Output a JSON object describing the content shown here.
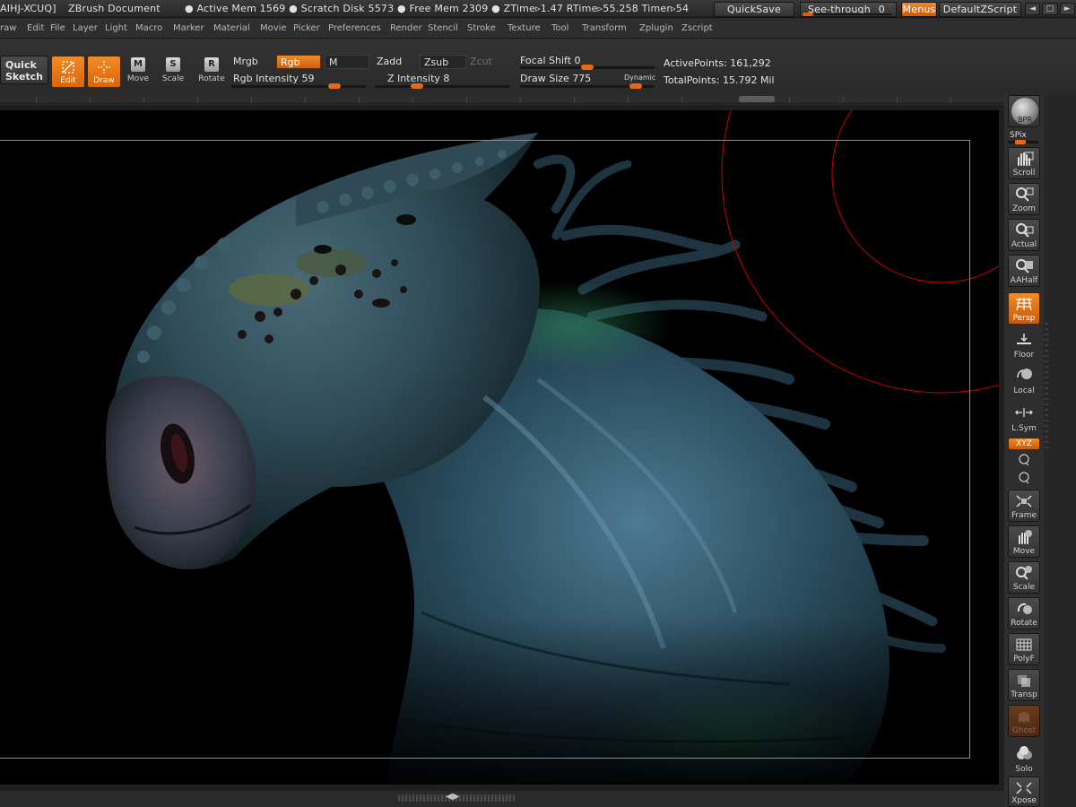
{
  "titlebar": {
    "id": "AIHJ-XCUQ]",
    "document": "ZBrush Document",
    "stats": "● Active Mem 1569 ● Scratch Disk 5573 ● Free Mem 2309 ● ZTime▹1.47 RTime▹55.258 Timer▹54",
    "quicksave": "QuickSave",
    "see_through_label": "See-through",
    "see_through_value": "0",
    "see_through_level": 0.0,
    "menus": "Menus",
    "default_zscript": "DefaultZScript",
    "window_controls": [
      "◄",
      "□",
      "►"
    ]
  },
  "menubar": {
    "items": [
      "raw",
      "Edit",
      "File",
      "Layer",
      "Light",
      "Macro",
      "Marker",
      "Material",
      "Movie",
      "Picker",
      "Preferences",
      "Render",
      "Stencil",
      "Stroke",
      "Texture",
      "Tool",
      "Transform",
      "Zplugin",
      "Zscript"
    ]
  },
  "shelf": {
    "quick_sketch_line1": "Quick",
    "quick_sketch_line2": "Sketch",
    "edit": "Edit",
    "draw": "Draw",
    "move": "Move",
    "scale": "Scale",
    "rotate": "Rotate",
    "move_key": "M",
    "scale_key": "S",
    "rotate_key": "R",
    "mrgb": "Mrgb",
    "rgb": "Rgb",
    "m": "M",
    "rgb_intensity_label": "Rgb Intensity",
    "rgb_intensity_value": "59",
    "zadd": "Zadd",
    "zsub": "Zsub",
    "zcut": "Zcut",
    "z_intensity_label": "Z Intensity",
    "z_intensity_value": "8",
    "focal_shift_label": "Focal Shift",
    "focal_shift_value": "0",
    "draw_size_label": "Draw Size",
    "draw_size_value": "775",
    "dynamic": "Dynamic",
    "active_points_label": "ActivePoints:",
    "active_points_value": "161,292",
    "total_points_label": "TotalPoints:",
    "total_points_value": "15.792 Mil"
  },
  "right_shelf": {
    "bpr": "BPR",
    "spix": "SPix",
    "scroll": "Scroll",
    "zoom": "Zoom",
    "actual": "Actual",
    "aahalf": "AAHalf",
    "persp": "Persp",
    "floor": "Floor",
    "local": "Local",
    "lsym": "L.Sym",
    "xyz": "XYZ",
    "frame": "Frame",
    "move": "Move",
    "scale": "Scale",
    "rotate": "Rotate",
    "polyf": "PolyF",
    "transp": "Transp",
    "ghost": "Ghost",
    "solo": "Solo",
    "xpose": "Xpose"
  },
  "colors": {
    "accent_orange": "#e86a10",
    "canvas_bg": "#000000",
    "brush_cursor": "#c80000"
  }
}
